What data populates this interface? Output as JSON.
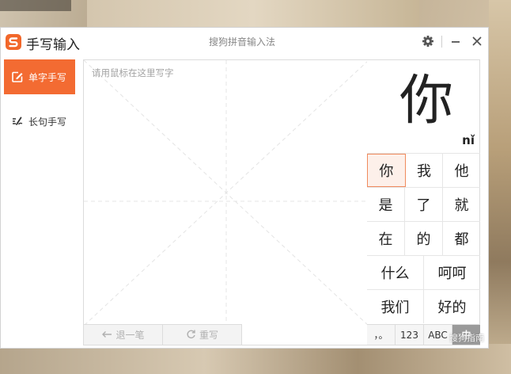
{
  "colors": {
    "accent": "#f36b32",
    "selected_border": "#f08a5d",
    "active_mode_bg": "#9a9a9a"
  },
  "titlebar": {
    "logo_icon": "sogou-s-logo-icon",
    "title": "手写输入",
    "ime_name": "搜狗拼音输入法",
    "settings_icon": "gear-icon",
    "minimize_icon": "minimize-icon",
    "close_icon": "close-icon"
  },
  "sidebar": {
    "items": [
      {
        "label": "单字手写",
        "icon": "edit-square-icon",
        "active": true
      },
      {
        "label": "长句手写",
        "icon": "handwrite-line-icon",
        "active": false
      }
    ]
  },
  "canvas": {
    "hint": "请用鼠标在这里写字",
    "undo_label": "退一笔",
    "undo_icon": "back-arrow-icon",
    "rewrite_label": "重写",
    "rewrite_icon": "refresh-icon"
  },
  "preview": {
    "character": "你",
    "pinyin": "nǐ"
  },
  "candidates": [
    [
      "你",
      "我",
      "他"
    ],
    [
      "是",
      "了",
      "就"
    ],
    [
      "在",
      "的",
      "都"
    ],
    [
      "什么",
      "呵呵"
    ],
    [
      "我们",
      "好的"
    ]
  ],
  "selected_candidate": "你",
  "modes": [
    {
      "label": "，。",
      "active": false
    },
    {
      "label": "123",
      "active": false
    },
    {
      "label": "ABC",
      "active": false
    },
    {
      "label": "中",
      "active": true
    }
  ],
  "watermark": "搜狗指南"
}
